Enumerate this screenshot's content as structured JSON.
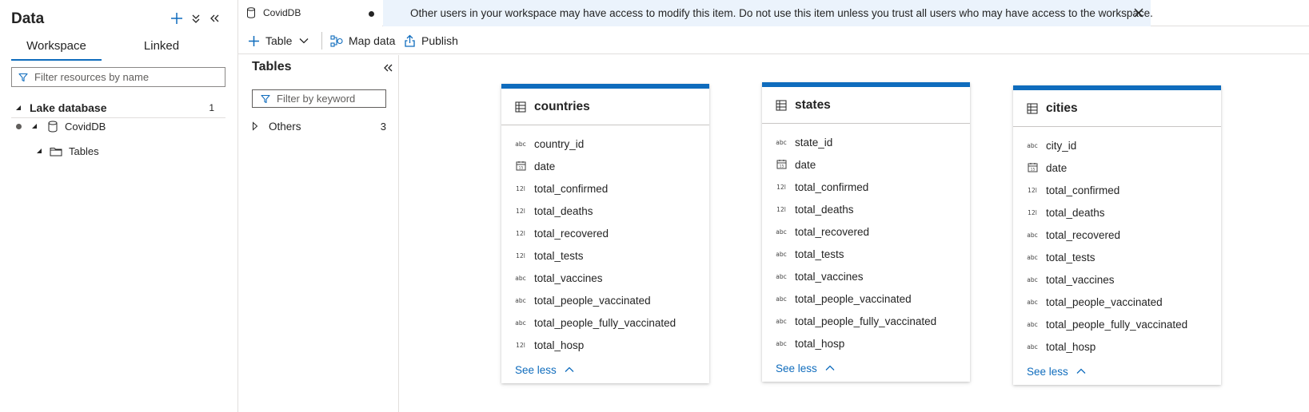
{
  "left_pane": {
    "title": "Data",
    "tabs": [
      {
        "label": "Workspace",
        "active": true
      },
      {
        "label": "Linked",
        "active": false
      }
    ],
    "filter_placeholder": "Filter resources by name",
    "tree": {
      "section_label": "Lake database",
      "section_count": "1",
      "database_label": "CovidDB",
      "folder_label": "Tables"
    }
  },
  "tab_strip": {
    "doc_tab_label": "CovidDB",
    "banner_message": "Other users in your workspace may have access to modify this item. Do not use this item unless you trust all users who may have access to the workspace."
  },
  "toolbar": {
    "table_label": "Table",
    "map_data_label": "Map data",
    "publish_label": "Publish"
  },
  "tables_pane": {
    "title": "Tables",
    "filter_placeholder": "Filter by keyword",
    "group_label": "Others",
    "group_count": "3"
  },
  "cards": [
    {
      "name": "countries",
      "columns": [
        {
          "name": "country_id",
          "type": "abc"
        },
        {
          "name": "date",
          "type": "date"
        },
        {
          "name": "total_confirmed",
          "type": "12l"
        },
        {
          "name": "total_deaths",
          "type": "12l"
        },
        {
          "name": "total_recovered",
          "type": "12l"
        },
        {
          "name": "total_tests",
          "type": "12l"
        },
        {
          "name": "total_vaccines",
          "type": "abc"
        },
        {
          "name": "total_people_vaccinated",
          "type": "abc"
        },
        {
          "name": "total_people_fully_vaccinated",
          "type": "abc"
        },
        {
          "name": "total_hosp",
          "type": "12l"
        }
      ],
      "see_less": "See less"
    },
    {
      "name": "states",
      "columns": [
        {
          "name": "state_id",
          "type": "abc"
        },
        {
          "name": "date",
          "type": "date"
        },
        {
          "name": "total_confirmed",
          "type": "12l"
        },
        {
          "name": "total_deaths",
          "type": "12l"
        },
        {
          "name": "total_recovered",
          "type": "abc"
        },
        {
          "name": "total_tests",
          "type": "abc"
        },
        {
          "name": "total_vaccines",
          "type": "abc"
        },
        {
          "name": "total_people_vaccinated",
          "type": "abc"
        },
        {
          "name": "total_people_fully_vaccinated",
          "type": "abc"
        },
        {
          "name": "total_hosp",
          "type": "abc"
        }
      ],
      "see_less": "See less"
    },
    {
      "name": "cities",
      "columns": [
        {
          "name": "city_id",
          "type": "abc"
        },
        {
          "name": "date",
          "type": "date"
        },
        {
          "name": "total_confirmed",
          "type": "12l"
        },
        {
          "name": "total_deaths",
          "type": "12l"
        },
        {
          "name": "total_recovered",
          "type": "abc"
        },
        {
          "name": "total_tests",
          "type": "abc"
        },
        {
          "name": "total_vaccines",
          "type": "abc"
        },
        {
          "name": "total_people_vaccinated",
          "type": "abc"
        },
        {
          "name": "total_people_fully_vaccinated",
          "type": "abc"
        },
        {
          "name": "total_hosp",
          "type": "abc"
        }
      ],
      "see_less": "See less"
    }
  ],
  "colors": {
    "accent": "#0f6cbd",
    "banner_bg": "#ebf3fc"
  }
}
